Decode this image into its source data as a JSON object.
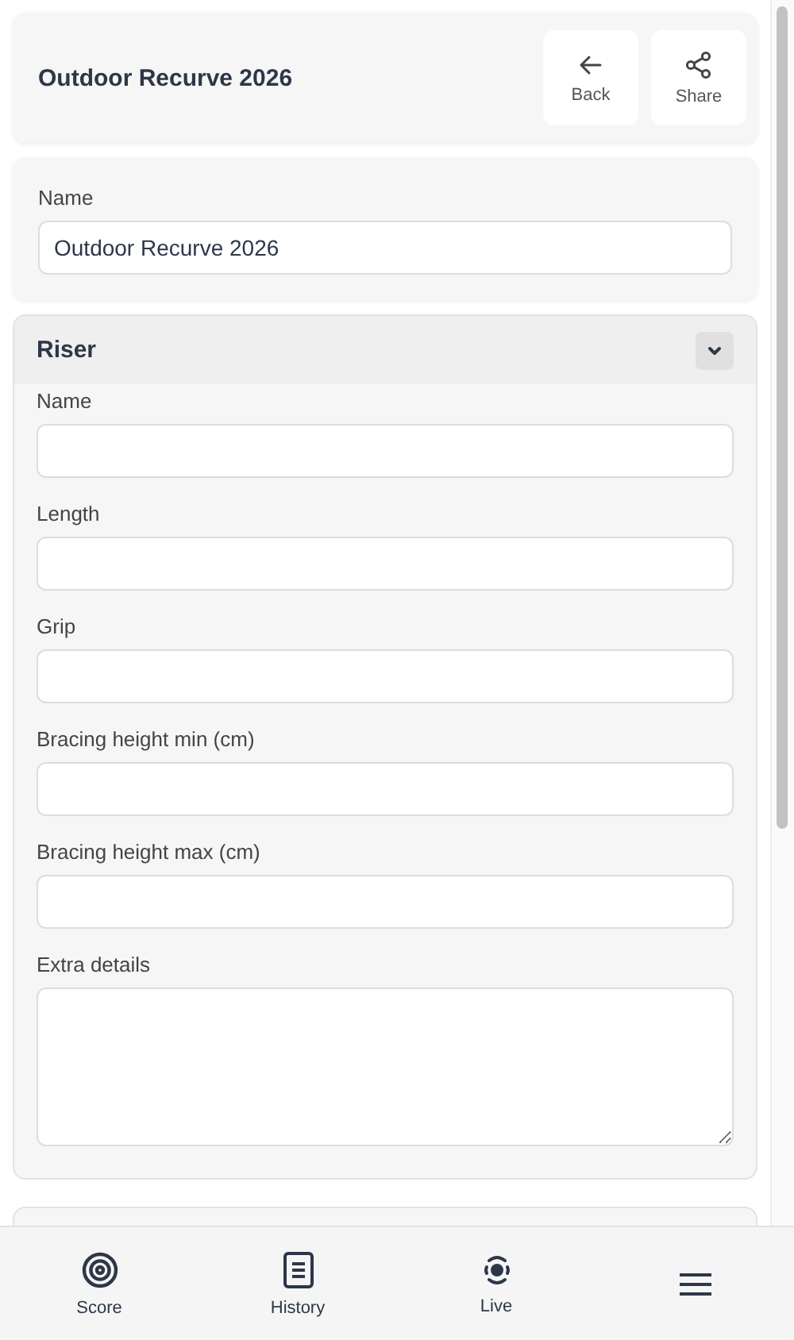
{
  "header": {
    "title": "Outdoor Recurve 2026",
    "actions": [
      {
        "label": "Back"
      },
      {
        "label": "Share"
      }
    ]
  },
  "name_card": {
    "label": "Name",
    "value": "Outdoor Recurve 2026"
  },
  "section": {
    "title": "Riser",
    "expanded": true,
    "fields": [
      {
        "label": "Name",
        "kind": "line"
      },
      {
        "label": "Length",
        "kind": "line"
      },
      {
        "label": "Grip",
        "kind": "line"
      },
      {
        "label": "Bracing height min (cm)",
        "kind": "line"
      },
      {
        "label": "Bracing height max (cm)",
        "kind": "line"
      },
      {
        "label": "Extra details",
        "kind": "multiline"
      }
    ]
  },
  "bottom_nav": [
    {
      "label": "Score",
      "kind": "tab"
    },
    {
      "label": "History",
      "kind": "tab"
    },
    {
      "label": "Live",
      "kind": "tab"
    },
    {
      "kind": "menu"
    }
  ]
}
